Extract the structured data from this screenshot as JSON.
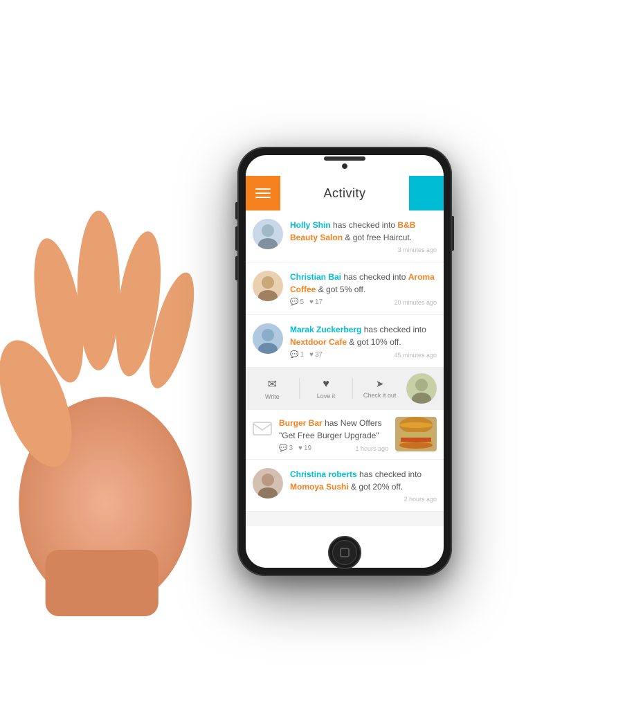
{
  "app": {
    "title": "Activity"
  },
  "header": {
    "menu_label": "Menu",
    "title": "Activity",
    "action_label": "Action"
  },
  "feed": {
    "items": [
      {
        "id": "item-1",
        "username": "Holly Shin",
        "action": "has checked into",
        "place": "B&B Beauty Salon",
        "reward": "& got free Haircut.",
        "timestamp": "3 minutes ago",
        "stats": null,
        "type": "checkin",
        "avatar_color": "#b0c4de"
      },
      {
        "id": "item-2",
        "username": "Christian Bai",
        "action": "has checked into",
        "place": "Aroma Coffee",
        "reward": "& got 5% off.",
        "timestamp": "20 minutes ago",
        "stats": {
          "comments": 5,
          "likes": 17
        },
        "type": "checkin",
        "avatar_color": "#c9a96e"
      },
      {
        "id": "item-3",
        "username": "Marak Zuckerberg",
        "action": "has checked into",
        "place": "Nextdoor Cafe",
        "reward": "& got 10% off.",
        "timestamp": "45 minutes ago",
        "stats": {
          "comments": 1,
          "likes": 37
        },
        "type": "checkin",
        "avatar_color": "#8fa8c0",
        "expanded": true
      },
      {
        "id": "item-4",
        "username": "Burger Bar",
        "action": "has New Offers",
        "place": "Burger Bar",
        "reward": "\"Get Free Burger Upgrade\"",
        "timestamp": "1 hours ago",
        "stats": {
          "comments": 3,
          "likes": 19
        },
        "type": "offer",
        "avatar_color": "#ddd"
      },
      {
        "id": "item-5",
        "username": "Christina roberts",
        "action": "has checked into",
        "place": "Momoya Sushi",
        "reward": "& got 20% off.",
        "timestamp": "2 hours ago",
        "stats": null,
        "type": "checkin",
        "avatar_color": "#c4b0a0"
      }
    ],
    "actions": [
      {
        "label": "Write",
        "icon": "✉"
      },
      {
        "label": "Love it",
        "icon": "♥"
      },
      {
        "label": "Check it out",
        "icon": "➤"
      }
    ]
  },
  "colors": {
    "orange": "#f5821f",
    "cyan": "#00bcd4",
    "gray_text": "#555",
    "light_gray": "#f5f5f5"
  }
}
